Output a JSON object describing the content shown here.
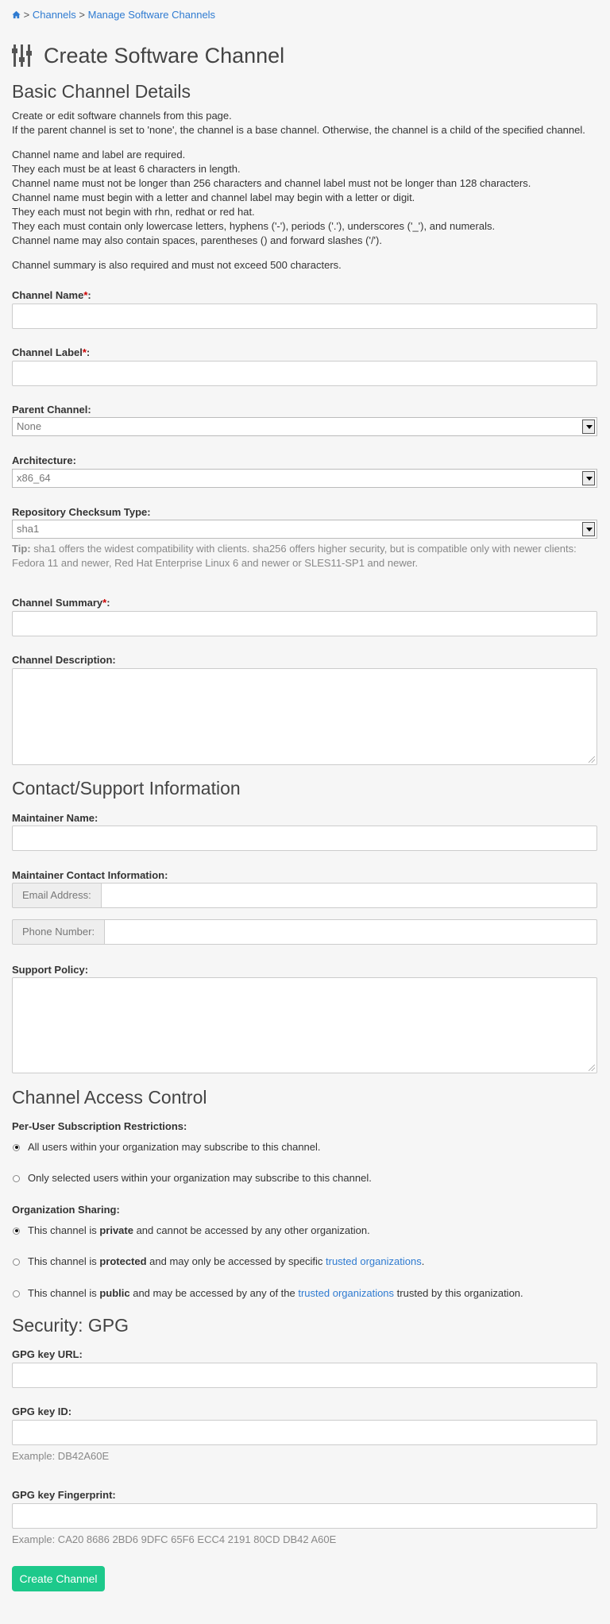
{
  "breadcrumb": {
    "channels": "Channels",
    "sep": ">",
    "manage": "Manage Software Channels"
  },
  "page_title": "Create Software Channel",
  "basic": {
    "heading": "Basic Channel Details",
    "intro1": "Create or edit software channels from this page.",
    "intro2": "If the parent channel is set to 'none', the channel is a base channel. Otherwise, the channel is a child of the specified channel.",
    "rules": [
      "Channel name and label are required.",
      "They each must be at least 6 characters in length.",
      "Channel name must not be longer than 256 characters and channel label must not be longer than 128 characters.",
      "Channel name must begin with a letter and channel label may begin with a letter or digit.",
      "They each must not begin with rhn, redhat or red hat.",
      "They each must contain only lowercase letters, hyphens ('-'), periods ('.'), underscores ('_'), and numerals.",
      "Channel name may also contain spaces, parentheses () and forward slashes ('/')."
    ],
    "summary_rule": "Channel summary is also required and must not exceed 500 characters.",
    "channel_name_label": "Channel Name",
    "channel_label_label": "Channel Label",
    "parent_label": "Parent Channel:",
    "parent_value": "None",
    "arch_label": "Architecture:",
    "arch_value": "x86_64",
    "checksum_label": "Repository Checksum Type:",
    "checksum_value": "sha1",
    "tip_prefix": "Tip:",
    "tip_text1": " sha1 offers the widest compatibility with clients. sha256 offers higher security, but is compatible only with newer clients:",
    "tip_text2": "Fedora 11 and newer, Red Hat Enterprise Linux 6 and newer or SLES11-SP1 and newer.",
    "summary_label": "Channel Summary",
    "description_label": "Channel Description:",
    "required_mark": "*",
    "colon": ":"
  },
  "contact": {
    "heading": "Contact/Support Information",
    "maintainer_name_label": "Maintainer Name:",
    "maintainer_contact_label": "Maintainer Contact Information:",
    "email_addon": "Email Address:",
    "phone_addon": "Phone Number:",
    "support_policy_label": "Support Policy:"
  },
  "access": {
    "heading": "Channel Access Control",
    "per_user_label": "Per-User Subscription Restrictions:",
    "per_user_all": "All users within your organization may subscribe to this channel.",
    "per_user_selected": "Only selected users within your organization may subscribe to this channel.",
    "org_sharing_label": "Organization Sharing:",
    "this_channel_is": "This channel is ",
    "private_word": "private",
    "private_rest": " and cannot be accessed by any other organization.",
    "protected_word": "protected",
    "protected_rest": " and may only be accessed by specific ",
    "protected_link": "trusted organizations",
    "period": ".",
    "public_word": "public",
    "public_rest": " and may be accessed by any of the ",
    "public_link": "trusted organizations",
    "public_tail": " trusted by this organization."
  },
  "gpg": {
    "heading": "Security: GPG",
    "url_label": "GPG key URL:",
    "id_label": "GPG key ID:",
    "id_example": "Example: DB42A60E",
    "fp_label": "GPG key Fingerprint:",
    "fp_example": "Example: CA20 8686 2BD6 9DFC 65F6 ECC4 2191 80CD DB42 A60E"
  },
  "submit_label": "Create Channel",
  "colors": {
    "link": "#2f7bd1",
    "button": "#1dc98b",
    "required": "#cc0000",
    "background": "#f6f6f6"
  }
}
